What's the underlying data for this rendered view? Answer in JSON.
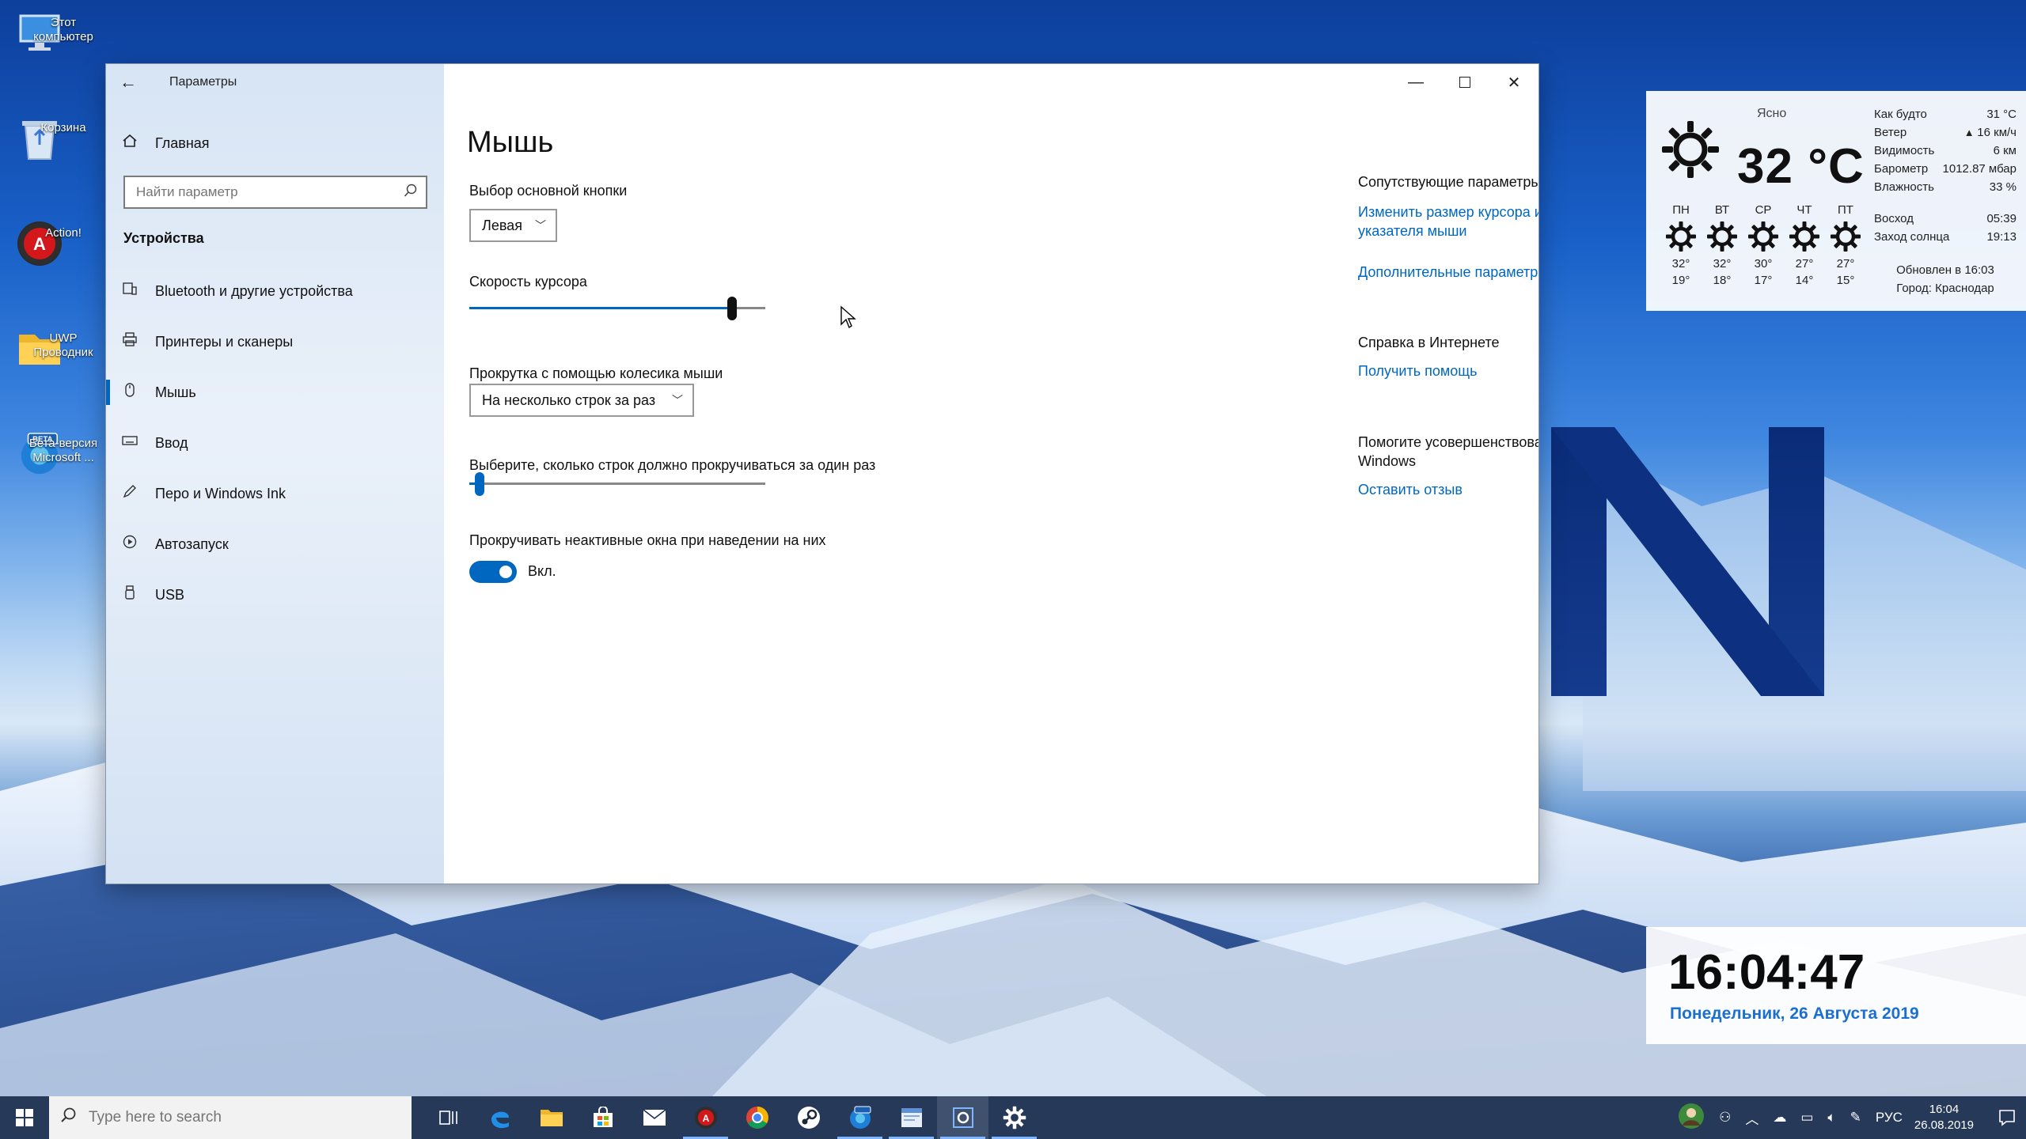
{
  "desktop": {
    "icons": [
      {
        "label": "Этот\nкомпьютер",
        "icon": "pc-icon"
      },
      {
        "label": "Корзина",
        "icon": "recycle-bin-icon"
      },
      {
        "label": "Action!",
        "icon": "action-app-icon"
      },
      {
        "label": "UWP\nПроводник",
        "icon": "folder-icon"
      },
      {
        "label": "Бета-версия\nMicrosoft ...",
        "icon": "edge-beta-icon"
      }
    ]
  },
  "weather": {
    "condition": "Ясно",
    "temp": "32 °C",
    "days": [
      {
        "name": "ПН",
        "high": "32°",
        "low": "19°"
      },
      {
        "name": "ВТ",
        "high": "32°",
        "low": "18°"
      },
      {
        "name": "СР",
        "high": "30°",
        "low": "17°"
      },
      {
        "name": "ЧТ",
        "high": "27°",
        "low": "14°"
      },
      {
        "name": "ПТ",
        "high": "27°",
        "low": "15°"
      }
    ],
    "feels_label": "Как будто",
    "feels_value": "31 °C",
    "wind_label": "Ветер",
    "wind_value": "16 км/ч",
    "visibility_label": "Видимость",
    "visibility_value": "6 км",
    "pressure_label": "Барометр",
    "pressure_value": "1012.87 мбар",
    "humidity_label": "Влажность",
    "humidity_value": "33 %",
    "sunrise_label": "Восход",
    "sunrise_value": "05:39",
    "sunset_label": "Заход солнца",
    "sunset_value": "19:13",
    "updated": "Обновлен в 16:03",
    "city": "Город: Краснодар"
  },
  "clock": {
    "time": "16:04:47",
    "date": "Понедельник, 26 Августа 2019"
  },
  "window": {
    "app_title": "Параметры",
    "home": "Главная",
    "search_placeholder": "Найти параметр",
    "section": "Устройства",
    "nav": [
      {
        "label": "Bluetooth и другие устройства",
        "icon": "bluetooth-device-icon"
      },
      {
        "label": "Принтеры и сканеры",
        "icon": "printer-icon"
      },
      {
        "label": "Мышь",
        "icon": "mouse-icon",
        "active": true
      },
      {
        "label": "Ввод",
        "icon": "keyboard-icon"
      },
      {
        "label": "Перо и Windows Ink",
        "icon": "pen-icon"
      },
      {
        "label": "Автозапуск",
        "icon": "autoplay-icon"
      },
      {
        "label": "USB",
        "icon": "usb-icon"
      }
    ],
    "page_title": "Мышь",
    "primary_button_label": "Выбор основной кнопки",
    "primary_button_value": "Левая",
    "cursor_speed_label": "Скорость курсора",
    "cursor_speed_fraction": 0.9,
    "scroll_label": "Прокрутка с помощью колесика мыши",
    "scroll_value": "На несколько строк за раз",
    "lines_label": "Выберите, сколько строк должно прокручиваться за один раз",
    "lines_fraction": 0.02,
    "inactive_label": "Прокручивать неактивные окна при наведении на них",
    "toggle_state": "Вкл.",
    "related_title": "Сопутствующие параметры",
    "related_link1": "Изменить размер курсора и указателя мыши",
    "related_link2": "Дополнительные параметры мыши",
    "help_title": "Справка в Интернете",
    "help_link": "Получить помощь",
    "improve_title": "Помогите усовершенствовать Windows",
    "improve_link": "Оставить отзыв"
  },
  "taskbar": {
    "search_placeholder": "Type here to search",
    "lang": "РУС",
    "time": "16:04",
    "date": "26.08.2019"
  },
  "colors": {
    "accent": "#0067c0",
    "clock_date": "#1a6fd0"
  }
}
